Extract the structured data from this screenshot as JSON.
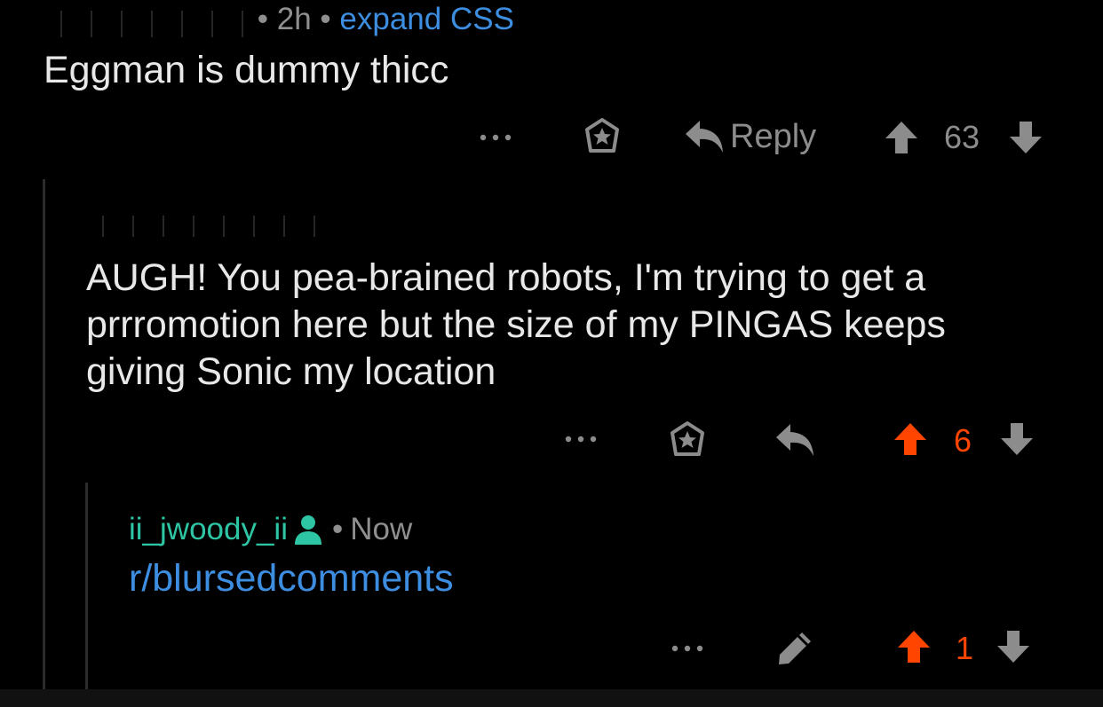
{
  "colors": {
    "background": "#000000",
    "text": "#e8e8e8",
    "muted": "#8c8c8c",
    "link": "#3d8ee0",
    "upvote": "#ff4500",
    "username": "#2ec5a5",
    "thread_line": "#2b2b2b"
  },
  "comment1": {
    "time": "2h",
    "expand": "expand CSS",
    "body": "Eggman is dummy thicc",
    "reply_label": "Reply",
    "score": "63",
    "icons": [
      "more-dots-icon",
      "award-icon",
      "reply-icon",
      "upvote-icon",
      "downvote-icon"
    ]
  },
  "comment2": {
    "body_lines": [
      "AUGH! You pea-brained robots, I'm trying to get a",
      "prrromotion here but the size of my PINGAS keeps",
      "giving Sonic my location"
    ],
    "score": "6",
    "upvoted": true,
    "icons": [
      "more-dots-icon",
      "award-icon",
      "reply-icon",
      "upvote-icon",
      "downvote-icon"
    ]
  },
  "comment3": {
    "username": "ii_jwoody_ii",
    "time": "Now",
    "body": "r/blursedcomments",
    "score": "1",
    "upvoted": true,
    "icons": [
      "user-icon",
      "more-dots-icon",
      "edit-pencil-icon",
      "upvote-icon",
      "downvote-icon"
    ]
  },
  "separator": "•"
}
